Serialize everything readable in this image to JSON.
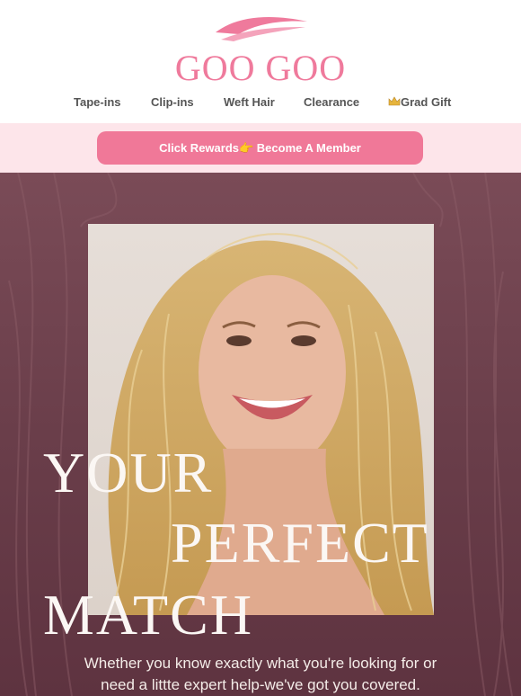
{
  "brand": {
    "name": "GOO GOO",
    "color": "#ef7a9c"
  },
  "nav": {
    "items": [
      {
        "label": "Tape-ins"
      },
      {
        "label": "Clip-ins"
      },
      {
        "label": "Weft Hair"
      },
      {
        "label": "Clearance"
      },
      {
        "label": "Grad Gift",
        "icon": "crown-icon"
      }
    ]
  },
  "rewards": {
    "label": "Click Rewards👉 Become A Member",
    "button_color": "#f07898",
    "band_color": "#fde5ea"
  },
  "hero": {
    "headline": [
      "YOUR",
      "PERFECT",
      "MATCH"
    ],
    "subtext_lines": [
      "Whether you know exactly what you're looking for or",
      "need a littte expert help-we've got you covered."
    ],
    "background_color": "#6a3e4a"
  }
}
